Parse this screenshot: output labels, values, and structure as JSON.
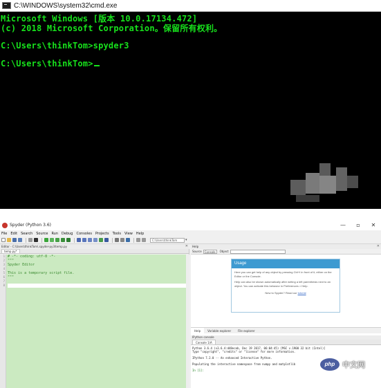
{
  "cmd": {
    "title": "C:\\WINDOWS\\system32\\cmd.exe",
    "lines": [
      "Microsoft Windows [版本 10.0.17134.472]",
      "(c) 2018 Microsoft Corporation。保留所有权利。",
      "",
      "C:\\Users\\thinkTom>spyder3",
      "",
      "C:\\Users\\thinkTom>"
    ],
    "text_color": "#17e21c",
    "bg_color": "#000000"
  },
  "spyder": {
    "title": "Spyder (Python 3.6)",
    "menu": [
      "File",
      "Edit",
      "Search",
      "Source",
      "Run",
      "Debug",
      "Consoles",
      "Projects",
      "Tools",
      "View",
      "Help"
    ],
    "toolbar_path": "C:\\Users\\thinkTom",
    "editor": {
      "pane_title": "Editor - C:\\Users\\thinkTom\\.spyder-py3\\temp.py",
      "tab_label": "temp.py*",
      "line_numbers": [
        "1",
        "2",
        "3",
        "4",
        "5",
        "6",
        "7",
        "8"
      ],
      "lines": [
        "# -*- coding: utf-8 -*-",
        "\"\"\"",
        "Spyder Editor",
        "",
        "This is a temporary script file.",
        "\"\"\"",
        "",
        ""
      ],
      "bg_color": "#cbeac1"
    },
    "help": {
      "pane_title": "Help",
      "source_label": "Source",
      "source_value": "Console",
      "object_label": "Object",
      "usage_title": "Usage",
      "usage_p1": "Here you can get help of any object by pressing Ctrl+I in front of it, either on the Editor or the Console.",
      "usage_p2": "Help can also be shown automatically after writing a left parenthesis next to an object. You can activate this behavior in Preferences > Help.",
      "usage_tut_prefix": "New to Spyder? Read our",
      "usage_tut_link": "tutorial",
      "tabs": [
        "Help",
        "Variable explorer",
        "File explorer"
      ]
    },
    "console": {
      "pane_title": "IPython console",
      "tab_label": "Console 1/A",
      "lines": [
        "Python 3.6.4 (v3.6.4:d48eceb, Dec 19 2017, 06:04:45) [MSC v.1900 32 bit (Intel)]",
        "Type \"copyright\", \"credits\" or \"license\" for more information.",
        "",
        "IPython 7.2.0 -- An enhanced Interactive Python.",
        "",
        "Populating the interactive namespace from numpy and matplotlib",
        "",
        "In [1]:"
      ]
    }
  },
  "watermark": {
    "badge": "php",
    "text": "中文网"
  }
}
